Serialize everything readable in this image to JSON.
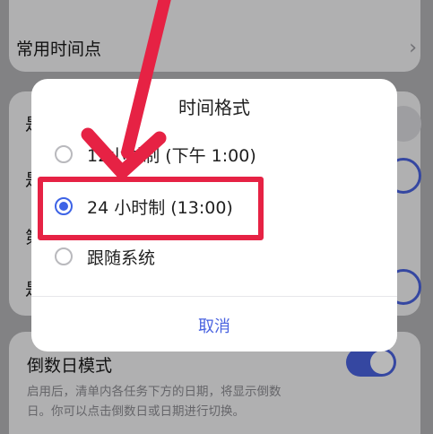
{
  "background": {
    "top_row_label": "常用时间点",
    "partial_rows": [
      "是",
      "是",
      "第",
      "是"
    ],
    "countdown": {
      "title": "倒数日模式",
      "description": "启用后，清单内各任务下方的日期，将显示倒数日。你可以点击倒数日或日期进行切换。"
    }
  },
  "dialog": {
    "title": "时间格式",
    "options": [
      {
        "label": "12小时制 (下午 1:00)",
        "selected": false
      },
      {
        "label": "24 小时制 (13:00)",
        "selected": true
      },
      {
        "label": "跟随系统",
        "selected": false
      }
    ],
    "cancel_label": "取消"
  },
  "colors": {
    "accent": "#4a63e0",
    "annotation": "#e62244"
  }
}
